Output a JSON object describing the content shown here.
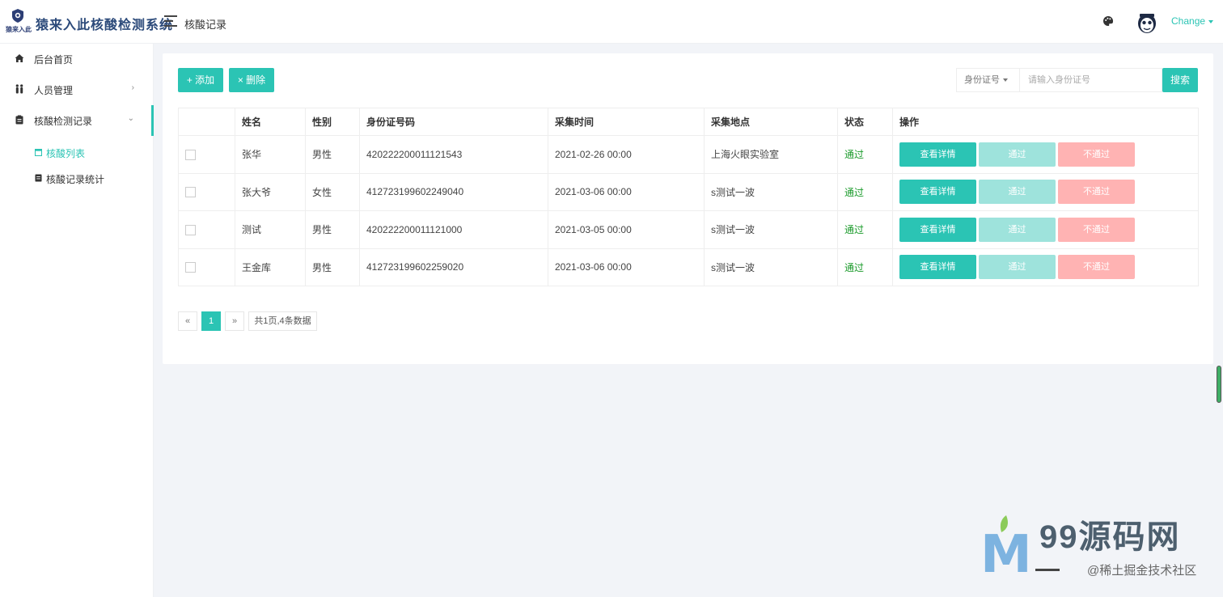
{
  "app": {
    "logo_small": "猿来入此",
    "logo_title": "猿来入此核酸检测系统",
    "page_heading": "核酸记录",
    "user_name": "Change"
  },
  "icons": {
    "menu": "menu-toggle-icon",
    "palette": "palette-icon",
    "avatar": "monkey-avatar-icon",
    "home": "home-icon",
    "people": "people-icon",
    "clipboard": "clipboard-icon",
    "calendar": "calendar-icon",
    "document": "document-icon"
  },
  "sidebar": {
    "items": [
      {
        "label": "后台首页",
        "arrow": ""
      },
      {
        "label": "人员管理",
        "arrow": "›"
      },
      {
        "label": "核酸检测记录",
        "arrow": "⌄"
      }
    ],
    "subitems": [
      {
        "label": "核酸列表"
      },
      {
        "label": "核酸记录统计"
      }
    ]
  },
  "toolbar": {
    "add_label": "+ 添加",
    "delete_label": "× 删除",
    "search_field": "身份证号",
    "search_placeholder": "请输入身份证号",
    "search_label": "搜索"
  },
  "table": {
    "headers": [
      "姓名",
      "性别",
      "身份证号码",
      "采集时间",
      "采集地点",
      "状态",
      "操作"
    ],
    "rows": [
      {
        "name": "张华",
        "gender": "男性",
        "id": "420222200011121543",
        "time": "2021-02-26 00:00",
        "place": "上海火眼实验室",
        "status": "通过"
      },
      {
        "name": "张大爷",
        "gender": "女性",
        "id": "412723199602249040",
        "time": "2021-03-06 00:00",
        "place": "s测试一波",
        "status": "通过"
      },
      {
        "name": "测试",
        "gender": "男性",
        "id": "420222200011121000",
        "time": "2021-03-05 00:00",
        "place": "s测试一波",
        "status": "通过"
      },
      {
        "name": "王金库",
        "gender": "男性",
        "id": "412723199602259020",
        "time": "2021-03-06 00:00",
        "place": "s测试一波",
        "status": "通过"
      }
    ],
    "actions": {
      "detail": "查看详情",
      "pass": "通过",
      "fail": "不通过"
    }
  },
  "pagination": {
    "prev": "«",
    "current": "1",
    "next": "»",
    "info": "共1页,4条数据"
  },
  "watermark": {
    "title": "99源码网",
    "subtitle": "@稀土掘金技术社区"
  },
  "colors": {
    "accent": "#2bc4b4",
    "pass_light": "#9ee3dc",
    "fail_light": "#ffb3b3",
    "status_ok": "#1a9a2a"
  }
}
